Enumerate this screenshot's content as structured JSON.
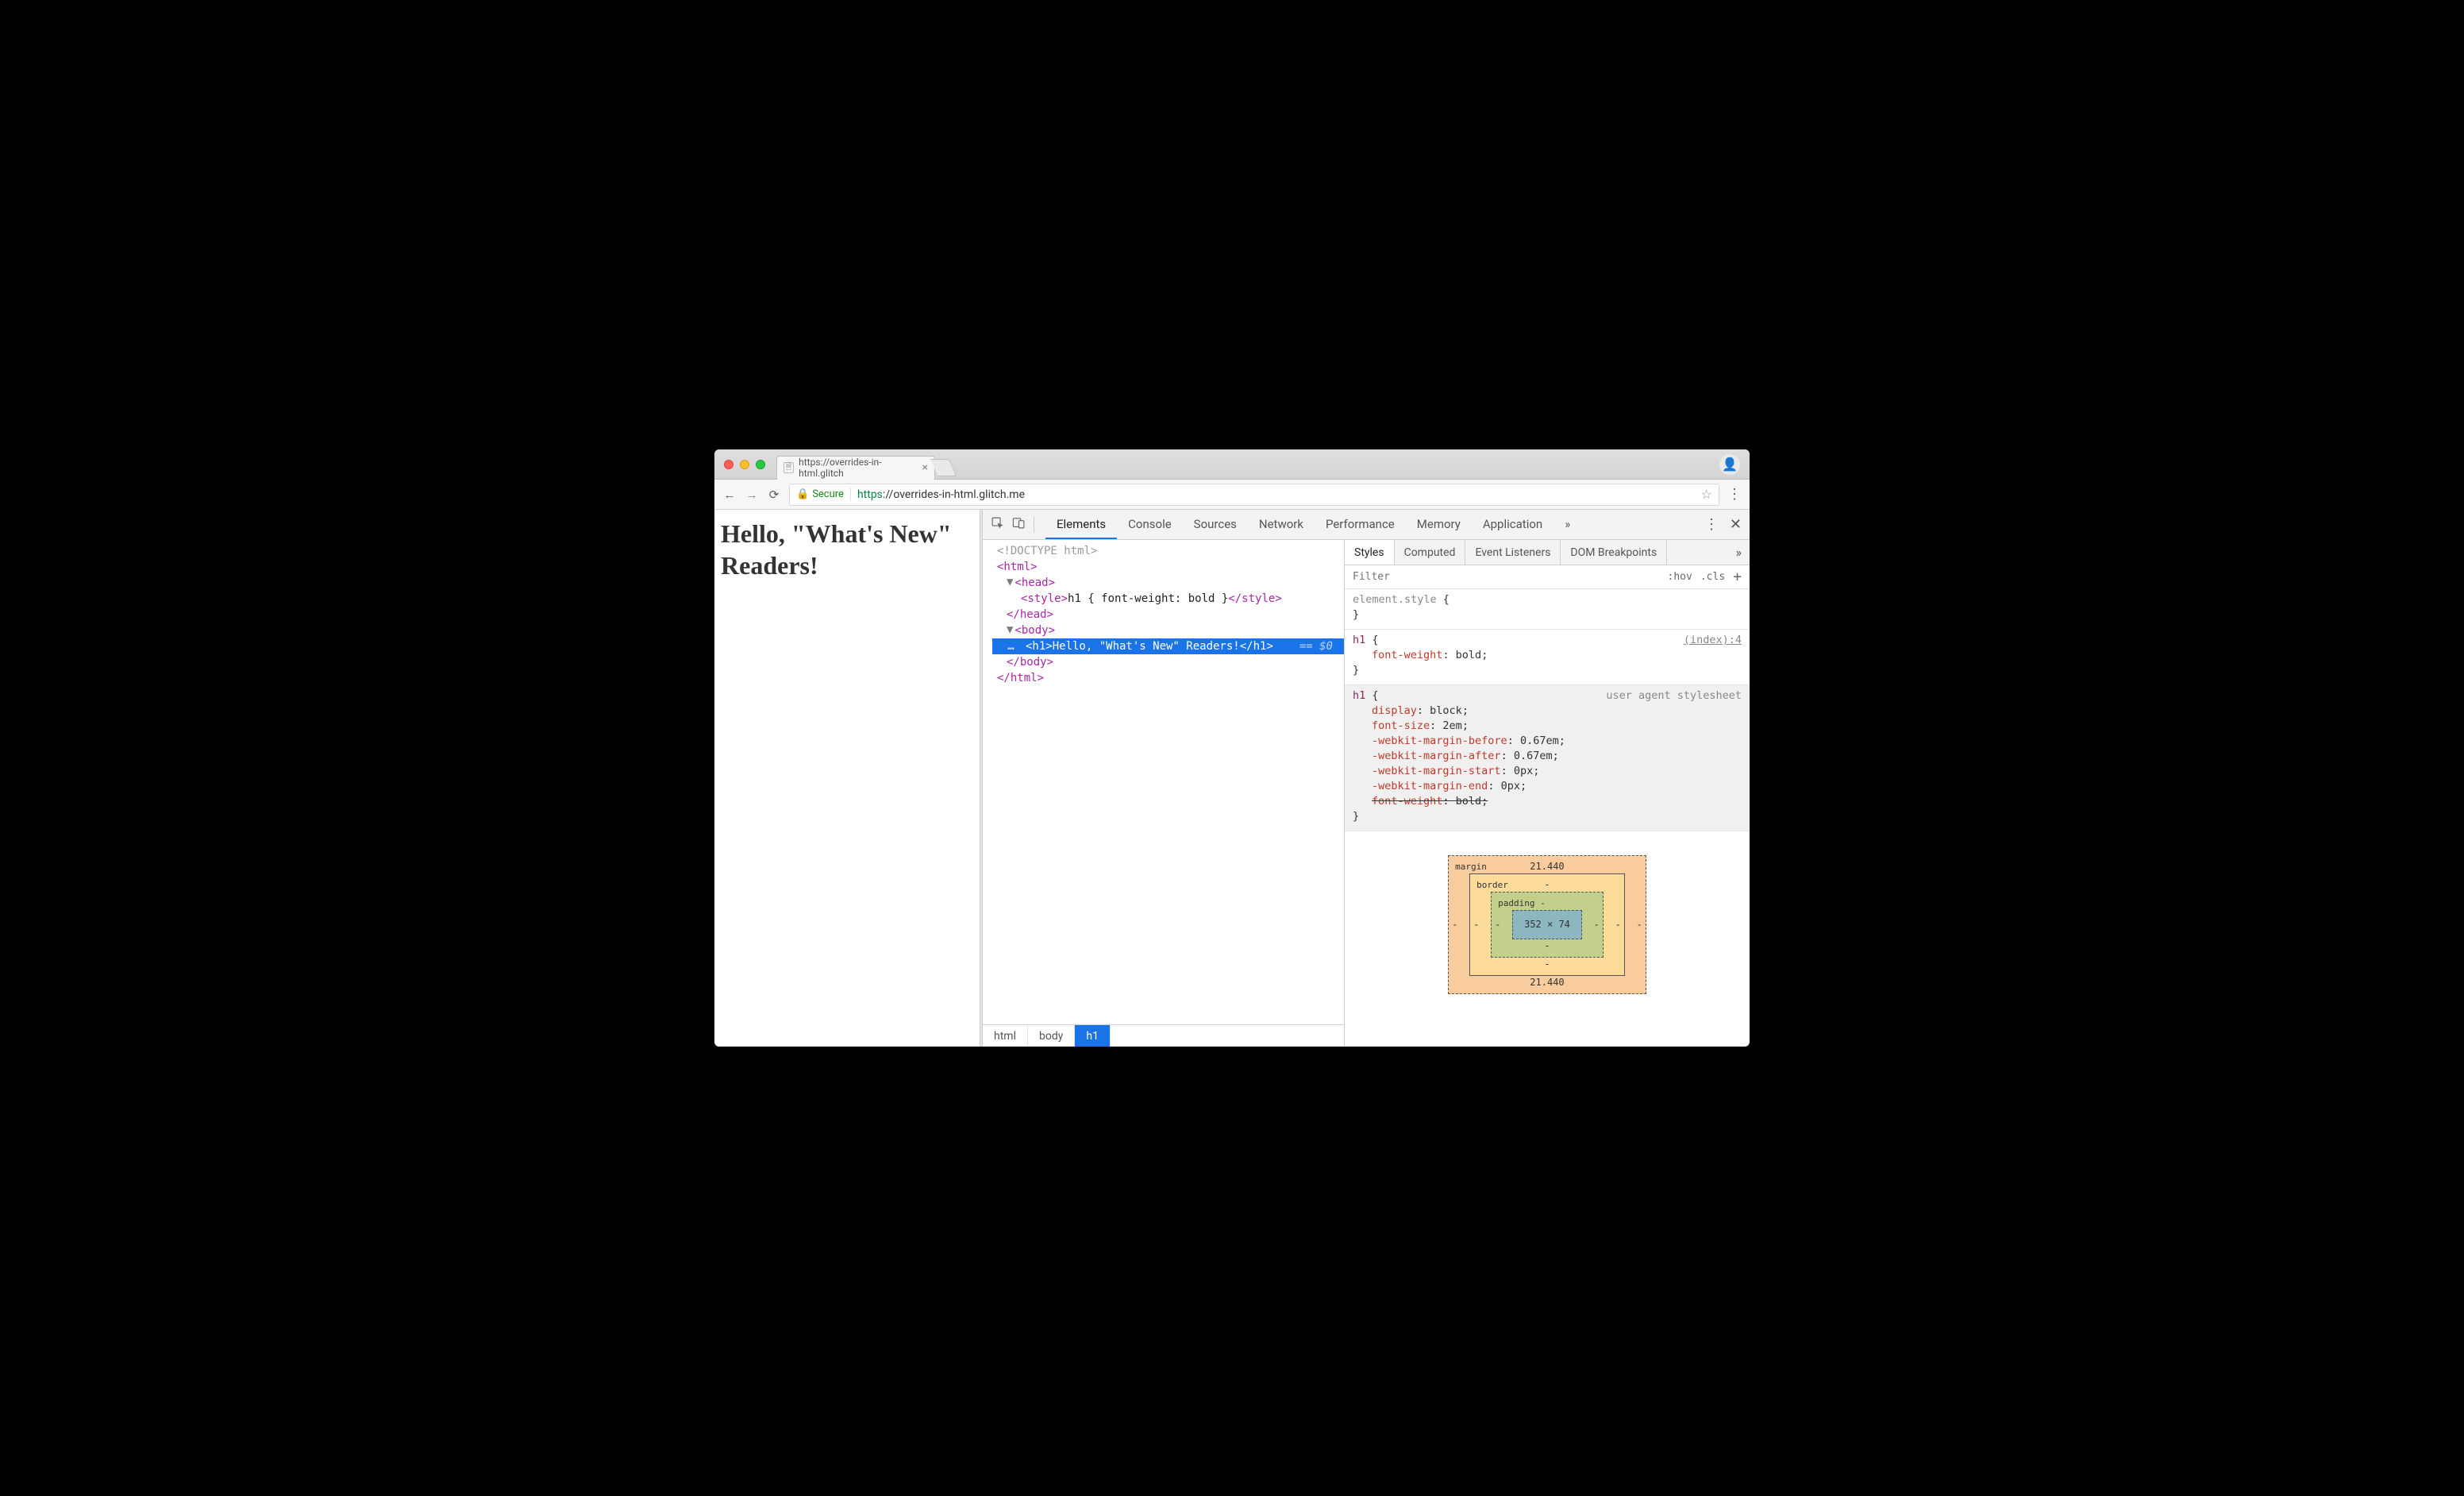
{
  "window": {
    "tab_title": "https://overrides-in-html.glitch",
    "avatar_glyph": "👤"
  },
  "toolbar": {
    "secure_label": "Secure",
    "url_host": "https",
    "url_rest": "://overrides-in-html.glitch.me"
  },
  "page": {
    "heading": "Hello, \"What's New\" Readers!"
  },
  "devtools": {
    "tabs": [
      "Elements",
      "Console",
      "Sources",
      "Network",
      "Performance",
      "Memory",
      "Application"
    ],
    "active_tab": "Elements",
    "overflow_glyph": "»"
  },
  "dom": {
    "doctype": "<!DOCTYPE html>",
    "html_open": "<html>",
    "head_open": "<head>",
    "style_open": "<style>",
    "style_text": "h1 { font-weight: bold }",
    "style_close": "</style>",
    "head_close": "</head>",
    "body_open": "<body>",
    "h1_open": "<h1>",
    "h1_text": "Hello, \"What's New\" Readers!",
    "h1_close": "</h1>",
    "sel_suffix": "== $0",
    "body_close": "</body>",
    "html_close": "</html>",
    "twisty": "▼",
    "gutter": "…"
  },
  "crumbs": [
    "html",
    "body",
    "h1"
  ],
  "sidebar": {
    "tabs": [
      "Styles",
      "Computed",
      "Event Listeners",
      "DOM Breakpoints"
    ],
    "active": "Styles",
    "more": "»",
    "filter_placeholder": "Filter",
    "hov": ":hov",
    "cls": ".cls",
    "plus": "+"
  },
  "rules": {
    "element_style": {
      "selector": "element.style",
      "decls": []
    },
    "h1_author": {
      "selector": "h1",
      "source": "(index):4",
      "decls": [
        {
          "prop": "font-weight",
          "val": "bold",
          "strike": false
        }
      ]
    },
    "h1_ua": {
      "selector": "h1",
      "source": "user agent stylesheet",
      "decls": [
        {
          "prop": "display",
          "val": "block",
          "strike": false
        },
        {
          "prop": "font-size",
          "val": "2em",
          "strike": false
        },
        {
          "prop": "-webkit-margin-before",
          "val": "0.67em",
          "strike": false
        },
        {
          "prop": "-webkit-margin-after",
          "val": "0.67em",
          "strike": false
        },
        {
          "prop": "-webkit-margin-start",
          "val": "0px",
          "strike": false
        },
        {
          "prop": "-webkit-margin-end",
          "val": "0px",
          "strike": false
        },
        {
          "prop": "font-weight",
          "val": "bold",
          "strike": true
        }
      ]
    }
  },
  "boxmodel": {
    "margin_label": "margin",
    "margin_top": "21.440",
    "margin_bottom": "21.440",
    "margin_left": "-",
    "margin_right": "-",
    "border_label": "border",
    "border_val": "-",
    "padding_label": "padding",
    "padding_val": "-",
    "content": "352 × 74"
  }
}
